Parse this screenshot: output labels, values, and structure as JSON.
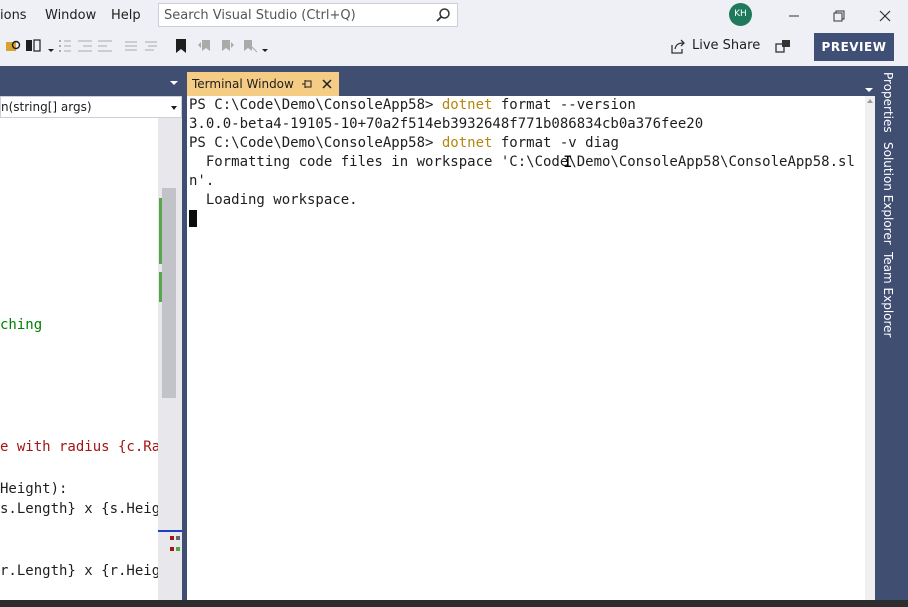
{
  "menu": {
    "items": [
      "ions",
      "Window",
      "Help"
    ]
  },
  "search": {
    "placeholder": "Search Visual Studio (Ctrl+Q)"
  },
  "user": {
    "initials": "KH"
  },
  "toolbar": {
    "live_share_label": "Live Share",
    "preview_label": "PREVIEW"
  },
  "editor": {
    "method_combo": "n(string[] args)",
    "code_lines": [
      {
        "text": "ching",
        "class": "c-green"
      },
      {
        "text": "e with radius {c.Ra",
        "class": "c-red"
      },
      {
        "text": "Height):",
        "class": ""
      },
      {
        "text": "s.Length} x {s.Heig",
        "class": ""
      },
      {
        "text": "r.Length} x {r.Heig",
        "class": ""
      }
    ]
  },
  "terminal": {
    "tab_label": "Terminal Window",
    "lines": [
      {
        "prefix": "PS C:\\Code\\Demo\\ConsoleApp58> ",
        "cmd": "dotnet",
        "rest": " format --version"
      },
      {
        "prefix": "3.0.0-beta4-19105-10+70a2f514eb3932648f771b086834cb0a376fee20",
        "cmd": "",
        "rest": ""
      },
      {
        "prefix": "PS C:\\Code\\Demo\\ConsoleApp58> ",
        "cmd": "dotnet",
        "rest": " format -v diag"
      },
      {
        "prefix": "  Formatting code files in workspace 'C:\\Code\\Demo\\ConsoleApp58\\ConsoleApp58.sl",
        "cmd": "",
        "rest": ""
      },
      {
        "prefix": "n'.",
        "cmd": "",
        "rest": ""
      },
      {
        "prefix": "  Loading workspace.",
        "cmd": "",
        "rest": ""
      }
    ]
  },
  "side_panel": {
    "tabs": [
      "Properties",
      "Solution Explorer",
      "Team Explorer"
    ]
  },
  "colors": {
    "accent": "#404e72",
    "tab_active": "#f5cc84",
    "command_keyword": "#b5870e",
    "avatar": "#1f7a5c"
  }
}
